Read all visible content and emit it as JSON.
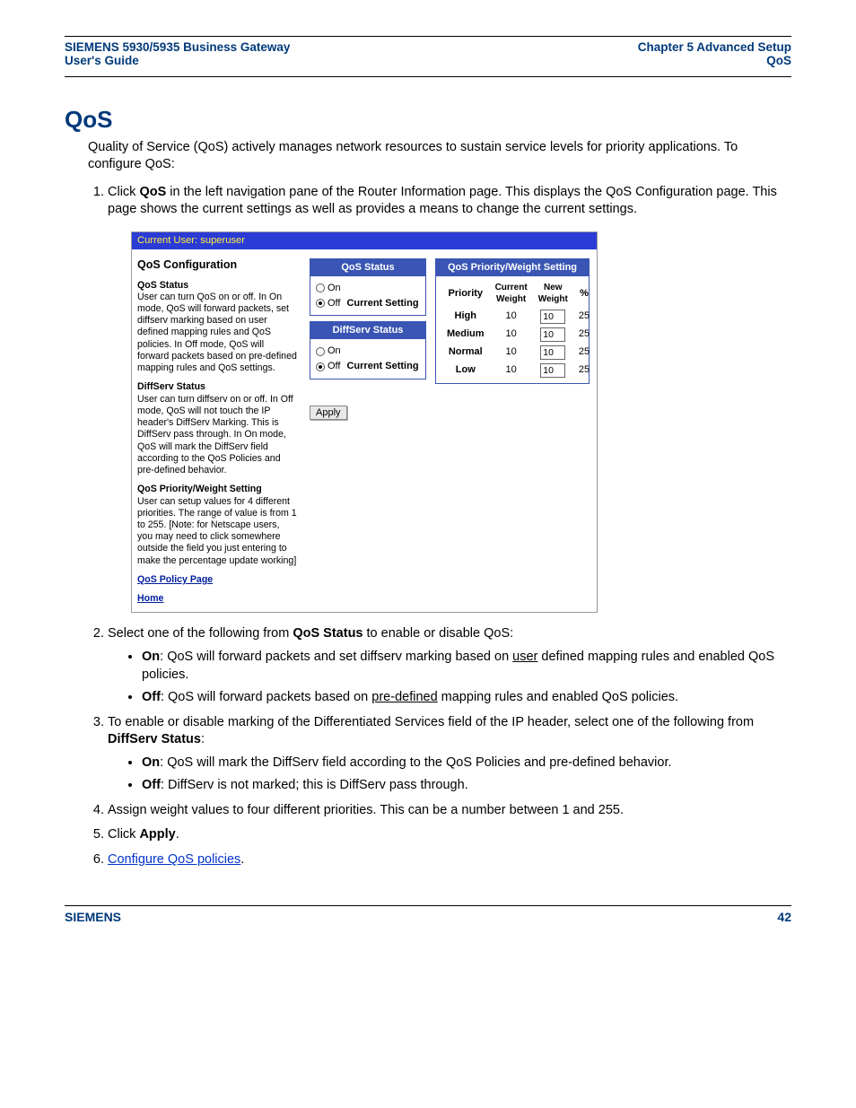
{
  "header": {
    "left_line1": "SIEMENS 5930/5935 Business Gateway",
    "left_line2": "User's Guide",
    "right_line1": "Chapter 5  Advanced Setup",
    "right_line2": "QoS"
  },
  "title": "QoS",
  "intro": "Quality of Service (QoS) actively manages network resources to sustain service levels for priority applications. To configure QoS:",
  "steps": {
    "s1_a": "Click ",
    "s1_bold": "QoS",
    "s1_b": " in the left navigation pane of the Router Information page. This displays the QoS Configuration page. This page shows the current settings as well as provides a means to change the current settings.",
    "s2_a": "Select one of the following from ",
    "s2_bold": "QoS Status",
    "s2_b": " to enable or disable QoS:",
    "s2_on_label": "On",
    "s2_on_text_a": ": QoS will forward packets and set diffserv marking based on ",
    "s2_on_user": "user",
    "s2_on_text_b": " defined mapping rules and enabled QoS policies.",
    "s2_off_label": "Off",
    "s2_off_text_a": ": QoS will forward packets based on ",
    "s2_off_pre": "pre-defined",
    "s2_off_text_b": " mapping rules and enabled QoS policies.",
    "s3_a": "To enable or disable marking of the Differentiated Services field of the IP header, select one of the following from ",
    "s3_bold": "DiffServ Status",
    "s3_b": ":",
    "s3_on_label": "On",
    "s3_on_text": ": QoS will mark the DiffServ field according to the QoS Policies and pre-defined behavior.",
    "s3_off_label": "Off",
    "s3_off_text": ": DiffServ is not marked; this is DiffServ pass through.",
    "s4": "Assign weight values to four different priorities. This can be a number between 1 and 255.",
    "s5_a": "Click ",
    "s5_bold": "Apply",
    "s5_b": ".",
    "s6_link": "Configure QoS policies",
    "s6_b": "."
  },
  "screenshot": {
    "userbar": "Current User: superuser",
    "sidebar": {
      "title": "QoS Configuration",
      "sec1_h": "QoS Status",
      "sec1_t": "User can turn QoS on or off. In On mode, QoS will forward packets, set diffserv marking based on user defined mapping rules and QoS policies. In Off mode, QoS will forward packets based on pre-defined mapping rules and QoS settings.",
      "sec2_h": "DiffServ Status",
      "sec2_t": "User can turn diffserv on or off. In Off mode, QoS will not touch the IP header's DiffServ Marking. This is DiffServ pass through. In On mode, QoS will mark the DiffServ field according to the QoS Policies and pre-defined behavior.",
      "sec3_h": "QoS Priority/Weight Setting",
      "sec3_t": "User can setup values for 4 different priorities. The range of value is from 1 to 255. [Note: for Netscape users, you may need to click somewhere outside the field you just entering to make the percentage update working]",
      "link1": "QoS Policy Page",
      "link2": "Home"
    },
    "qos_status": {
      "title": "QoS Status",
      "on": "On",
      "off": "Off",
      "current": "Current Setting"
    },
    "diffserv_status": {
      "title": "DiffServ Status",
      "on": "On",
      "off": "Off",
      "current": "Current Setting"
    },
    "priority_table": {
      "title": "QoS Priority/Weight Setting",
      "h_priority": "Priority",
      "h_current": "Current Weight",
      "h_new": "New Weight",
      "h_pct": "%",
      "rows": [
        {
          "label": "High",
          "current": "10",
          "new": "10",
          "pct": "25"
        },
        {
          "label": "Medium",
          "current": "10",
          "new": "10",
          "pct": "25"
        },
        {
          "label": "Normal",
          "current": "10",
          "new": "10",
          "pct": "25"
        },
        {
          "label": "Low",
          "current": "10",
          "new": "10",
          "pct": "25"
        }
      ]
    },
    "apply": "Apply"
  },
  "footer": {
    "left": "SIEMENS",
    "right": "42"
  }
}
